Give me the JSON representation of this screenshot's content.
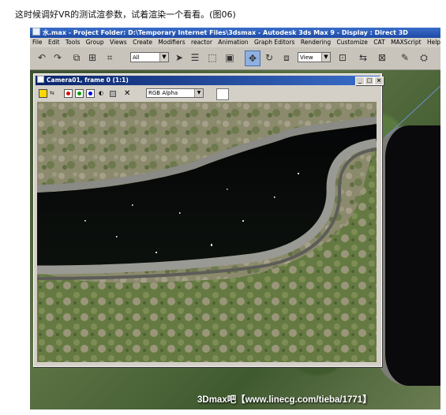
{
  "caption": "这时候调好VR的测试渲参数，试着渲染一个看看。(图06)",
  "app": {
    "title": "水.max  - Project Folder: D:\\Temporary Internet Files\\3dsmax    - Autodesk 3ds Max 9     - Display : Direct 3D",
    "menu": [
      "File",
      "Edit",
      "Tools",
      "Group",
      "Views",
      "Create",
      "Modifiers",
      "reactor",
      "Animation",
      "Graph Editors",
      "Rendering",
      "Customize",
      "CAT",
      "MAXScript",
      "Help"
    ],
    "toolbar": {
      "selection_filter": "All",
      "reference_coord": "View"
    }
  },
  "render_window": {
    "title": "Camera01, frame 0 (1:1)",
    "channel": "RGB Alpha",
    "minimize": "_",
    "maximize": "□",
    "close": "×"
  },
  "watermark": "3Dmax吧【www.linecg.com/tieba/1771】",
  "colors": {
    "title_blue": "#1d4aa6",
    "render_title": "#0a246a",
    "swatch_red": "#e00000",
    "swatch_green": "#00a000",
    "swatch_blue": "#0000e0"
  }
}
